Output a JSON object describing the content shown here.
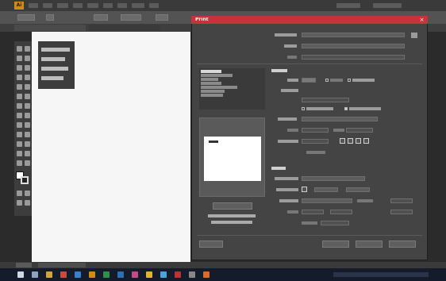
{
  "app": {
    "logo": "Ai",
    "menu_items": [
      "",
      "",
      "",
      "",
      "",
      "",
      "",
      "",
      ""
    ]
  },
  "control_bar": {
    "items": [
      "",
      "",
      "",
      "",
      ""
    ]
  },
  "document_tabs": [
    "",
    ""
  ],
  "panel": {
    "items": [
      "",
      "",
      "",
      ""
    ]
  },
  "dialog": {
    "title": "Print",
    "close_glyph": "×",
    "header_fields": [
      {
        "label": "",
        "value": ""
      },
      {
        "label": "",
        "value": ""
      },
      {
        "label": "",
        "value": ""
      }
    ],
    "nav_items": [
      "",
      "",
      "",
      "",
      "",
      "",
      "",
      "",
      ""
    ],
    "nav_selected_index": 0,
    "section_general": {
      "heading": "",
      "copies_label": "",
      "copies_value": "",
      "collate_label": "",
      "reverse_label": "",
      "artboards_label": "",
      "range_value": "",
      "ignore_artboards_label": "",
      "skip_blank_label": ""
    },
    "section_media": {
      "heading": "",
      "size_label": "",
      "size_value": "",
      "width_label": "",
      "height_label": "",
      "orientation_label": "",
      "transverse_label": ""
    },
    "section_options": {
      "heading": "",
      "print_layers_label": "",
      "print_layers_value": "",
      "placement_label": "",
      "placement_x": "",
      "placement_y": "",
      "scaling_label": "",
      "scaling_value": "",
      "overlap_label": "",
      "scale_label": "",
      "tile_label": ""
    },
    "preview_caption": [
      "",
      ""
    ],
    "buttons": {
      "setup": "",
      "done": "",
      "print": "",
      "cancel": "",
      "preview_toggle": ""
    }
  },
  "colors": {
    "dialog_title": "#c8323a",
    "app_logo": "#d08a1c",
    "taskbar": "#141b2a"
  }
}
